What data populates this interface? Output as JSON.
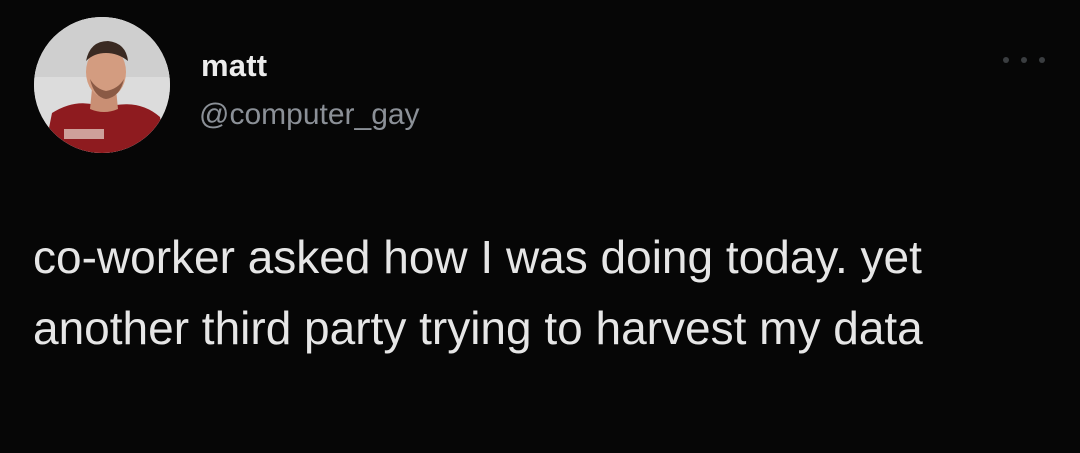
{
  "tweet": {
    "author": {
      "display_name": "matt",
      "handle": "@computer_gay",
      "avatar_icon": "profile-photo"
    },
    "more_icon": "more-horizontal-icon",
    "text": "co-worker asked how I was doing today. yet another third party trying to harvest my data"
  },
  "colors": {
    "background": "#060606",
    "text": "#e6e6e6",
    "handle": "#8b9097"
  }
}
